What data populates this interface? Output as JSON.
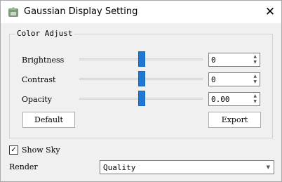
{
  "window": {
    "title": "Gaussian Display Setting",
    "close_glyph": "✕",
    "app_icon": "gaussian-app-icon"
  },
  "color_adjust": {
    "legend": "Color Adjust",
    "rows": [
      {
        "label": "Brightness",
        "value": "0",
        "slider_level": 0.5
      },
      {
        "label": "Contrast",
        "value": "0",
        "slider_level": 0.5
      },
      {
        "label": "Opacity",
        "value": "0.00",
        "slider_level": 0.5
      }
    ],
    "default_button": "Default",
    "export_button": "Export"
  },
  "show_sky": {
    "label": "Show Sky",
    "checked": true,
    "check_glyph": "✓"
  },
  "render": {
    "label": "Render",
    "value": "Quality"
  },
  "colors": {
    "accent": "#1f78d6"
  }
}
